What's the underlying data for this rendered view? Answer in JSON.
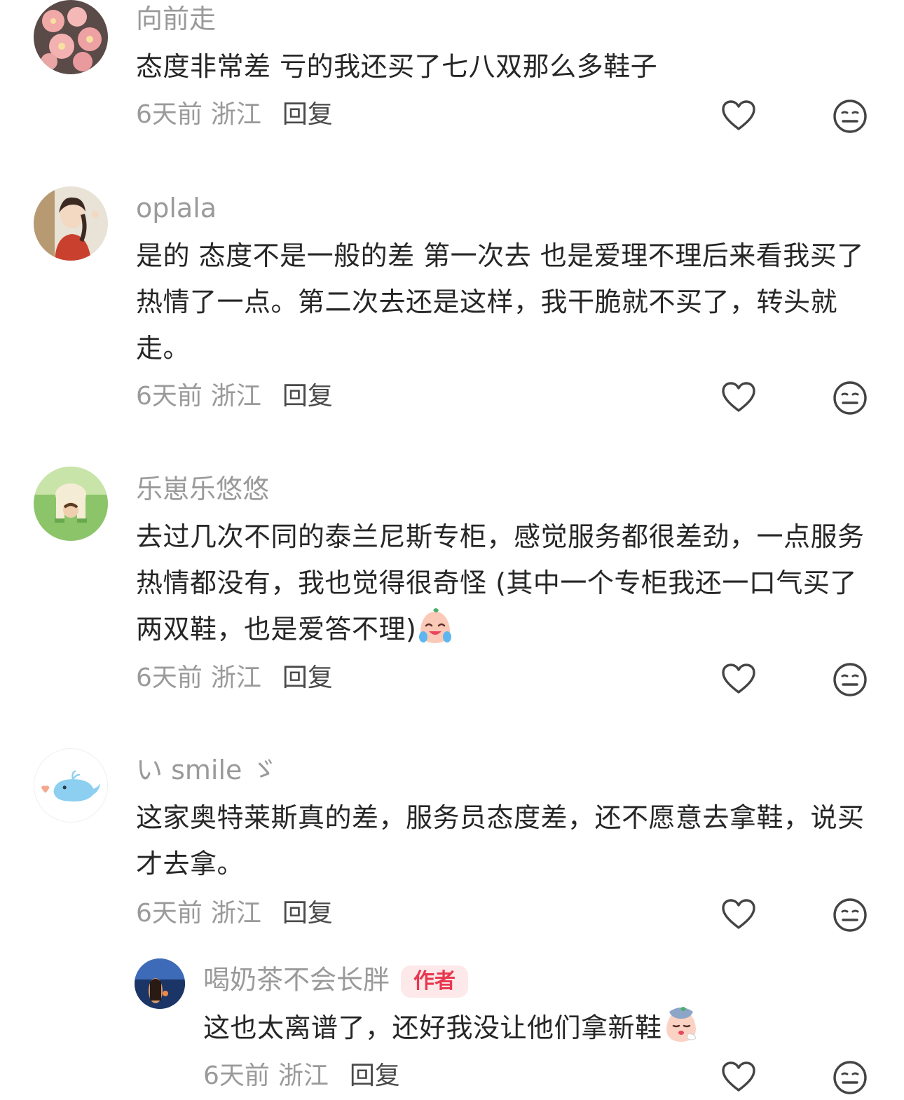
{
  "comments": [
    {
      "user": "向前走",
      "avatar": "flower-avatar",
      "text": "态度非常差 亏的我还买了七八双那么多鞋子",
      "time": "6天前",
      "location": "浙江",
      "reply_label": "回复"
    },
    {
      "user": "oplala",
      "avatar": "girl-avatar",
      "text": "是的 态度不是一般的差  第一次去 也是爱理不理后来看我买了 热情了一点。第二次去还是这样，我干脆就不买了，转头就走。",
      "time": "6天前",
      "location": "浙江",
      "reply_label": "回复"
    },
    {
      "user": "乐崽乐悠悠",
      "avatar": "child-on-grass-avatar",
      "text": "去过几次不同的泰兰尼斯专柜，感觉服务都很差劲，一点服务热情都没有，我也觉得很奇怪 (其中一个专柜我还一口气买了两双鞋，也是爱答不理)",
      "emoji": "crying-laughing-emoji",
      "time": "6天前",
      "location": "浙江",
      "reply_label": "回复"
    },
    {
      "user": "い smile ゞ",
      "avatar": "whale-avatar",
      "text": "这家奥特莱斯真的差，服务员态度差，还不愿意去拿鞋，说买才去拿。",
      "time": "6天前",
      "location": "浙江",
      "reply_label": "回复"
    }
  ],
  "reply": {
    "user": "喝奶茶不会长胖",
    "badge": "作者",
    "avatar": "sunset-sea-avatar",
    "text": "这也太离谱了，还好我没让他们拿新鞋",
    "emoji": "sad-face-emoji",
    "time": "6天前",
    "location": "浙江",
    "reply_label": "回复"
  },
  "icons": {
    "like": "heart-outline-icon",
    "dislike": "neutral-face-icon"
  },
  "colors": {
    "username": "#9a9a9a",
    "text": "#262626",
    "meta": "#9a9a9a",
    "badge_bg": "#fde8ea",
    "badge_text": "#e8384f"
  }
}
